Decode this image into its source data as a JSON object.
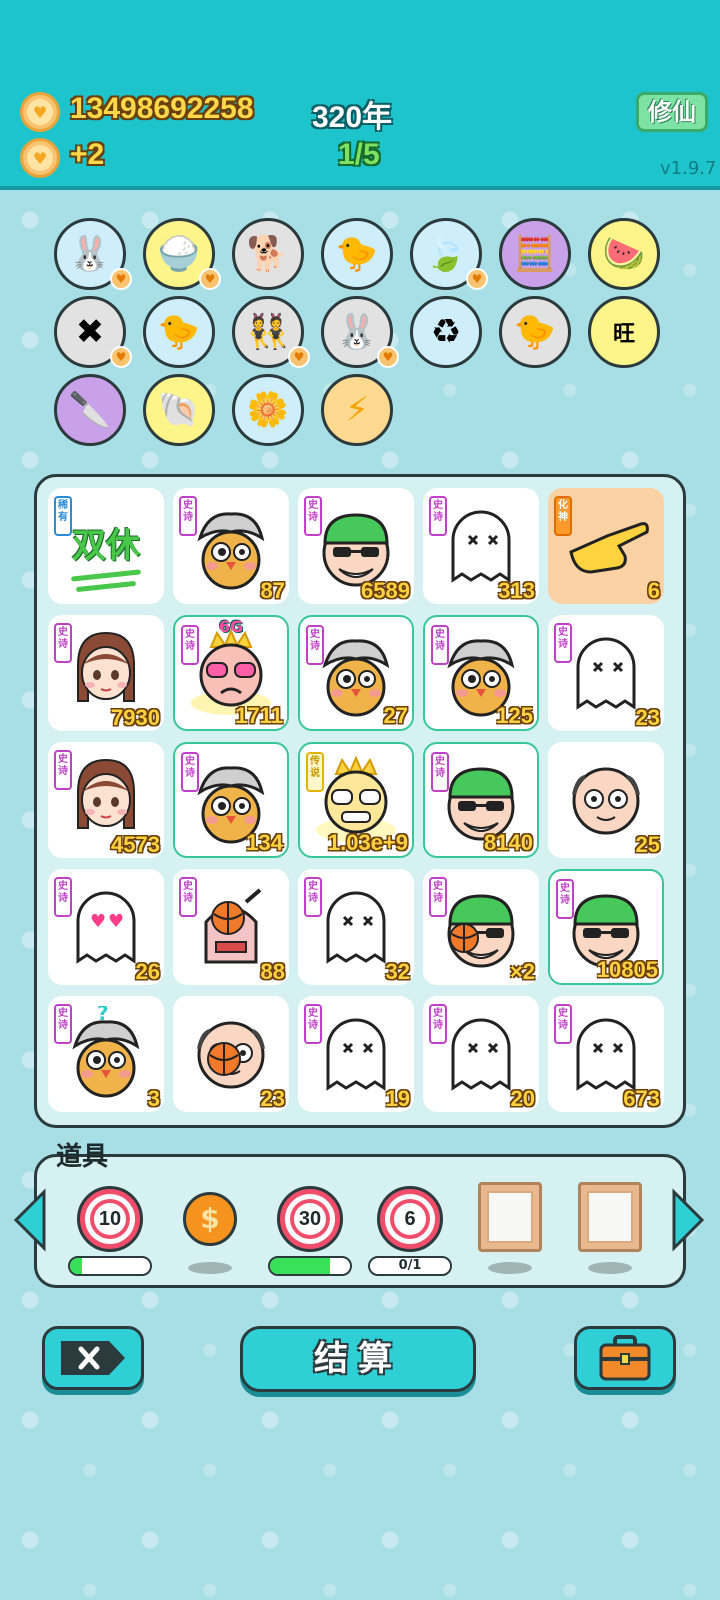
{
  "header": {
    "coins": "13498692258",
    "coin_rate": "+2",
    "year": "320年",
    "progress": "1/5",
    "mode_button": "修仙",
    "version": "v1.9.7"
  },
  "collection": [
    {
      "name": "rabbit",
      "bg": "#cfeefc",
      "heart": true
    },
    {
      "name": "rice-bowl",
      "bg": "#fdf58a",
      "heart": true
    },
    {
      "name": "dog",
      "bg": "#e2e2e2",
      "heart": false
    },
    {
      "name": "chick-egg",
      "bg": "#cfeefc",
      "heart": false
    },
    {
      "name": "leaf",
      "bg": "#cfeefc",
      "heart": true
    },
    {
      "name": "math-face",
      "bg": "#c9a1e8",
      "heart": false
    },
    {
      "name": "fruit-basket",
      "bg": "#fdf58a",
      "heart": false
    },
    {
      "name": "x-tag",
      "bg": "#e2e2e2",
      "heart": true
    },
    {
      "name": "chick-egg-2",
      "bg": "#cfeefc",
      "heart": false
    },
    {
      "name": "twins",
      "bg": "#e2e2e2",
      "heart": true
    },
    {
      "name": "rabbit-2",
      "bg": "#e2e2e2",
      "heart": true
    },
    {
      "name": "recycle-bag",
      "bg": "#cfeefc",
      "heart": false
    },
    {
      "name": "chick-egg-3",
      "bg": "#e2e2e2",
      "heart": false
    },
    {
      "name": "wang-wang",
      "bg": "#fdf58a",
      "heart": false
    },
    {
      "name": "cleaver",
      "bg": "#c9a1e8",
      "heart": false
    },
    {
      "name": "shell",
      "bg": "#fdf58a",
      "heart": false
    },
    {
      "name": "flower-pot",
      "bg": "#cfeefc",
      "heart": false
    },
    {
      "name": "lightning",
      "bg": "#ffd990",
      "heart": false
    }
  ],
  "tiles": [
    {
      "tag": "稀有",
      "tagc": "blue",
      "art": "双休",
      "count": "",
      "hl": false,
      "peach": false
    },
    {
      "tag": "史诗",
      "tagc": "purple",
      "art": "chick-grey",
      "count": "87",
      "hl": false,
      "peach": false
    },
    {
      "tag": "史诗",
      "tagc": "purple",
      "art": "green-hat",
      "count": "6589",
      "hl": false,
      "peach": false
    },
    {
      "tag": "史诗",
      "tagc": "purple",
      "art": "ghost",
      "count": "313",
      "hl": false,
      "peach": false
    },
    {
      "tag": "化神",
      "tagc": "orange",
      "art": "hand",
      "count": "6",
      "hl": false,
      "peach": true
    },
    {
      "tag": "史诗",
      "tagc": "purple",
      "art": "girl",
      "count": "7930",
      "hl": false,
      "peach": false
    },
    {
      "tag": "史诗",
      "tagc": "purple",
      "art": "king-pink",
      "count": "1711",
      "hl": true,
      "peach": false,
      "top": "6G"
    },
    {
      "tag": "史诗",
      "tagc": "purple",
      "art": "chick-grey",
      "count": "27",
      "hl": true,
      "peach": false
    },
    {
      "tag": "史诗",
      "tagc": "purple",
      "art": "chick-grey",
      "count": "125",
      "hl": true,
      "peach": false
    },
    {
      "tag": "史诗",
      "tagc": "purple",
      "art": "ghost",
      "count": "23",
      "hl": false,
      "peach": false
    },
    {
      "tag": "史诗",
      "tagc": "purple",
      "art": "girl",
      "count": "4573",
      "hl": false,
      "peach": false
    },
    {
      "tag": "史诗",
      "tagc": "purple",
      "art": "chick-grey",
      "count": "134",
      "hl": true,
      "peach": false
    },
    {
      "tag": "传说",
      "tagc": "yellow",
      "art": "king-gold",
      "count": "1.03e+9",
      "hl": true,
      "peach": false
    },
    {
      "tag": "史诗",
      "tagc": "purple",
      "art": "green-hat",
      "count": "8140",
      "hl": true,
      "peach": false
    },
    {
      "tag": "",
      "tagc": "purple",
      "art": "bald",
      "count": "25",
      "hl": false,
      "peach": false
    },
    {
      "tag": "史诗",
      "tagc": "purple",
      "art": "ghost-heart",
      "count": "26",
      "hl": false,
      "peach": false
    },
    {
      "tag": "史诗",
      "tagc": "purple",
      "art": "basketball-box",
      "count": "88",
      "hl": false,
      "peach": false
    },
    {
      "tag": "史诗",
      "tagc": "purple",
      "art": "ghost",
      "count": "32",
      "hl": false,
      "peach": false
    },
    {
      "tag": "史诗",
      "tagc": "purple",
      "art": "green-hat-ball",
      "count": "×2",
      "hl": false,
      "peach": false
    },
    {
      "tag": "史诗",
      "tagc": "purple",
      "art": "green-hat",
      "count": "10805",
      "hl": true,
      "peach": false
    },
    {
      "tag": "史诗",
      "tagc": "purple",
      "art": "chick-grey-q",
      "count": "3",
      "hl": false,
      "peach": false
    },
    {
      "tag": "",
      "tagc": "purple",
      "art": "bald-ball",
      "count": "23",
      "hl": false,
      "peach": false
    },
    {
      "tag": "史诗",
      "tagc": "purple",
      "art": "ghost",
      "count": "19",
      "hl": false,
      "peach": false
    },
    {
      "tag": "史诗",
      "tagc": "purple",
      "art": "ghost",
      "count": "20",
      "hl": false,
      "peach": false
    },
    {
      "tag": "史诗",
      "tagc": "purple",
      "art": "ghost",
      "count": "673",
      "hl": false,
      "peach": false
    }
  ],
  "tools": {
    "title": "道具",
    "items": [
      {
        "type": "target",
        "value": "10",
        "bar": 0.15
      },
      {
        "type": "coin",
        "value": "$"
      },
      {
        "type": "target",
        "value": "30",
        "bar": 0.75
      },
      {
        "type": "target",
        "value": "6",
        "bar_label": "0/1"
      },
      {
        "type": "frame"
      },
      {
        "type": "frame"
      }
    ]
  },
  "buttons": {
    "settle": "结算"
  }
}
